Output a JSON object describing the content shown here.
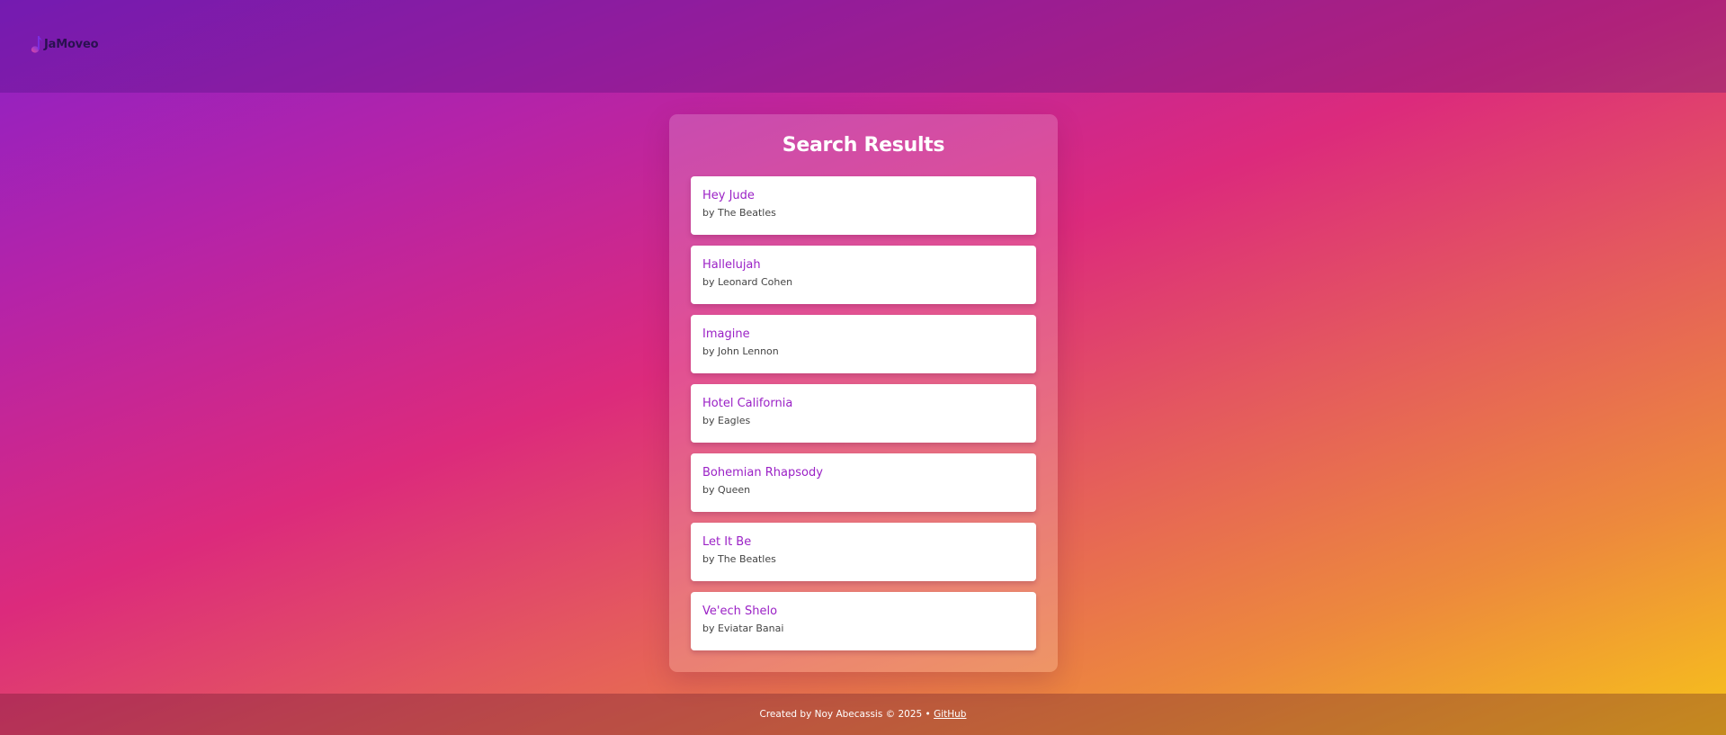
{
  "header": {
    "logo_text": "JaMoveo",
    "logo_icon": "music-note-icon"
  },
  "results_panel": {
    "title": "Search Results",
    "results": [
      {
        "title": "Hey Jude",
        "artist": "by The Beatles"
      },
      {
        "title": "Hallelujah",
        "artist": "by Leonard Cohen"
      },
      {
        "title": "Imagine",
        "artist": "by John Lennon"
      },
      {
        "title": "Hotel California",
        "artist": "by Eagles"
      },
      {
        "title": "Bohemian Rhapsody",
        "artist": "by Queen"
      },
      {
        "title": "Let It Be",
        "artist": "by The Beatles"
      },
      {
        "title": "Ve'ech Shelo",
        "artist": "by Eviatar Banai"
      }
    ]
  },
  "footer": {
    "credit_text": "Created by Noy Abecassis © 2025 • ",
    "link_label": "GitHub"
  },
  "colors": {
    "accent": "#9b22c6",
    "gradient_start": "#8a22c8",
    "gradient_mid": "#dc2a7c",
    "gradient_end": "#f7c31a"
  }
}
